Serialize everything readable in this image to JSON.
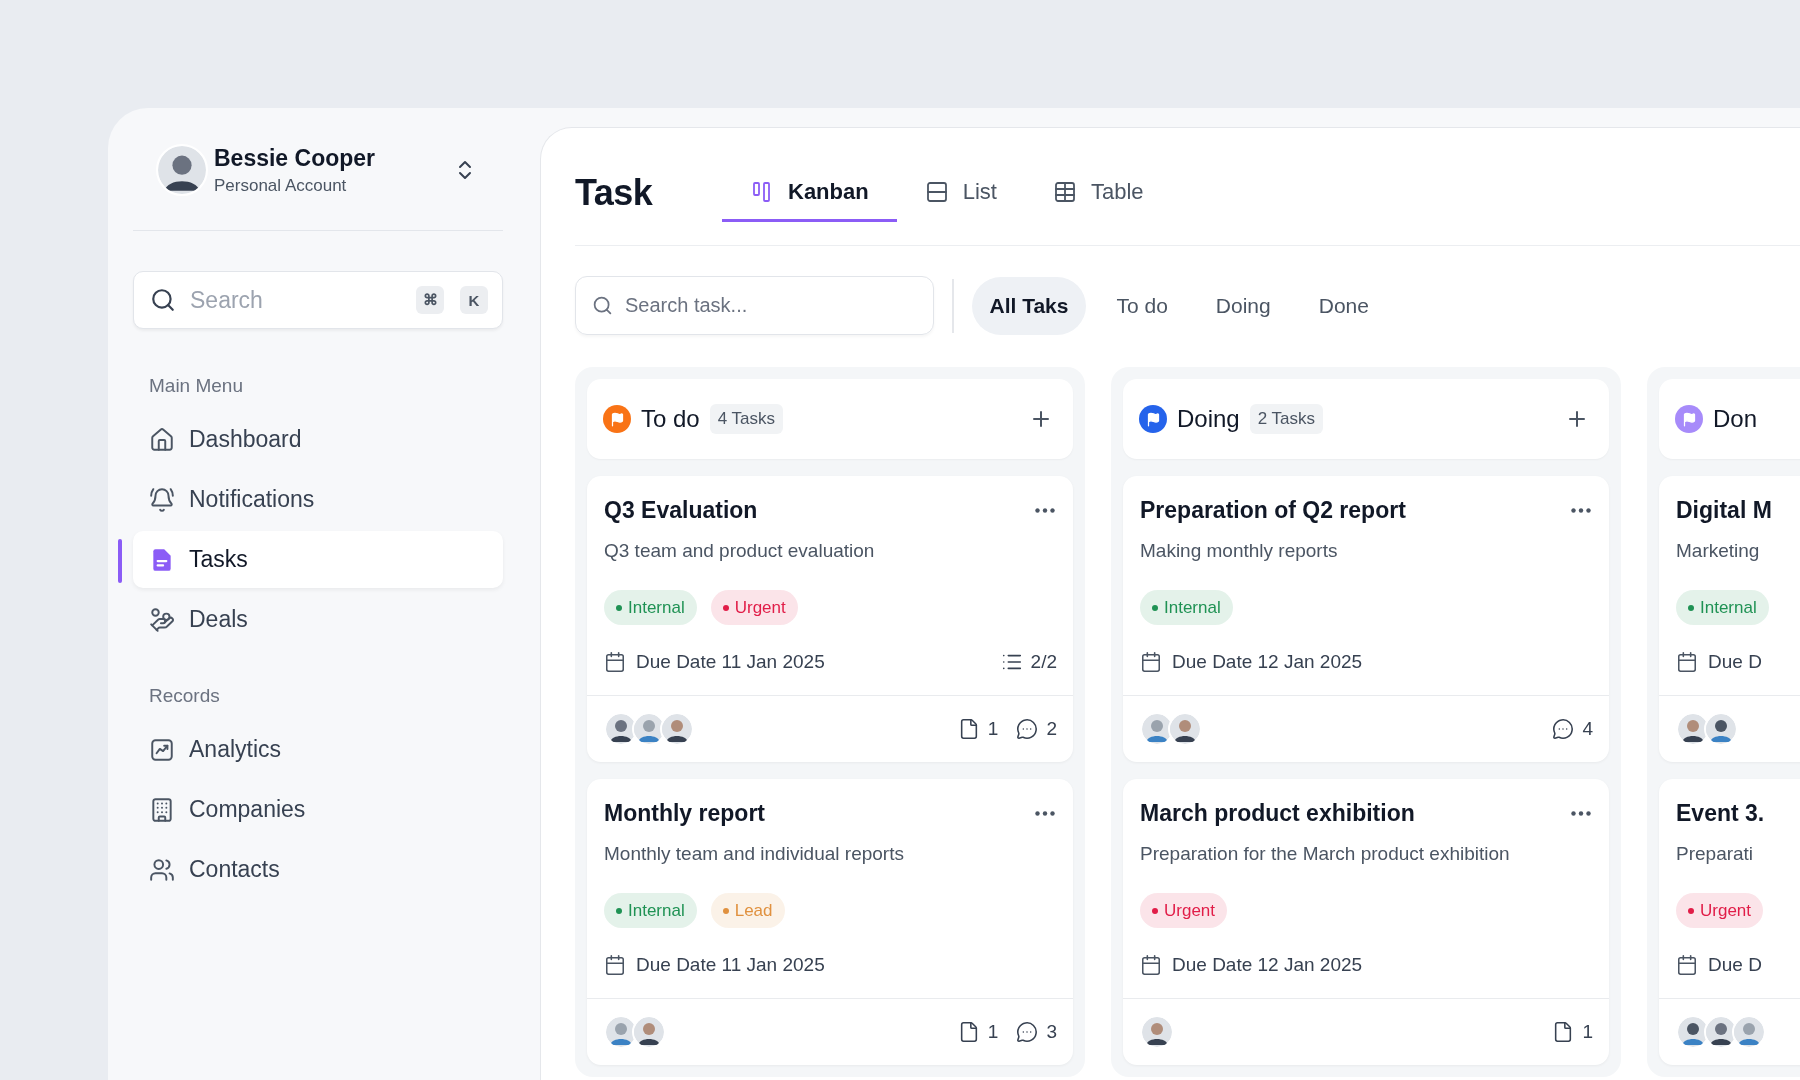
{
  "profile": {
    "name": "Bessie Cooper",
    "account": "Personal Account",
    "avatar": {
      "kind": "picture"
    }
  },
  "sidebar_search": {
    "placeholder": "Search",
    "keys": [
      "⌘",
      "K"
    ]
  },
  "sidebar": {
    "sections": [
      {
        "title": "Main Menu",
        "items": [
          {
            "label": "Dashboard",
            "selected": false
          },
          {
            "label": "Notifications",
            "selected": false
          },
          {
            "label": "Tasks",
            "selected": true
          },
          {
            "label": "Deals",
            "selected": false
          }
        ]
      },
      {
        "title": "Records",
        "items": [
          {
            "label": "Analytics",
            "selected": false
          },
          {
            "label": "Companies",
            "selected": false
          },
          {
            "label": "Contacts",
            "selected": false
          }
        ]
      }
    ]
  },
  "page_title": "Task",
  "view_tabs": [
    {
      "label": "Kanban",
      "selected": true
    },
    {
      "label": "List",
      "selected": false
    },
    {
      "label": "Table",
      "selected": false
    }
  ],
  "task_search": {
    "placeholder": "Search task..."
  },
  "filters": [
    {
      "label": "All Taks",
      "selected": true
    },
    {
      "label": "To do",
      "selected": false
    },
    {
      "label": "Doing",
      "selected": false
    },
    {
      "label": "Done",
      "selected": false
    }
  ],
  "columns": [
    {
      "title": "To do",
      "count": "4 Tasks",
      "color": "#f97316",
      "cards": [
        {
          "title": "Q3 Evaluation",
          "description": "Q3 team and product evaluation",
          "tags": [
            {
              "label": "Internal",
              "color": "#1f9254"
            },
            {
              "label": "Urgent",
              "color": "#e11d48"
            }
          ],
          "due": "Due Date 11 Jan 2025",
          "subtasks": "2/2",
          "avatars": [
            {
              "kind": "picture"
            },
            {
              "kind": "picture"
            },
            {
              "kind": "picture"
            }
          ],
          "attachments": "1",
          "comments": "2"
        },
        {
          "title": "Monthly report",
          "description": "Monthly team and individual reports",
          "tags": [
            {
              "label": "Internal",
              "color": "#1f9254"
            },
            {
              "label": "Lead",
              "color": "#e0913f"
            }
          ],
          "due": "Due Date 11 Jan 2025",
          "avatars": [
            {
              "kind": "picture"
            },
            {
              "kind": "picture"
            }
          ],
          "attachments": "1",
          "comments": "3"
        }
      ]
    },
    {
      "title": "Doing",
      "count": "2 Tasks",
      "color": "#2563eb",
      "cards": [
        {
          "title": "Preparation of Q2 report",
          "description": "Making monthly reports",
          "tags": [
            {
              "label": "Internal",
              "color": "#1f9254"
            }
          ],
          "due": "Due Date 12 Jan 2025",
          "avatars": [
            {
              "kind": "picture"
            },
            {
              "kind": "picture"
            }
          ],
          "comments": "4"
        },
        {
          "title": "March product exhibition",
          "description": "Preparation for the March product exhibition",
          "tags": [
            {
              "label": "Urgent",
              "color": "#e11d48"
            }
          ],
          "due": "Due Date 12 Jan 2025",
          "avatars": [
            {
              "kind": "picture"
            }
          ],
          "attachments": "1"
        }
      ]
    },
    {
      "title": "Don",
      "color": "#a78bfa",
      "cards": [
        {
          "title": "Digital M",
          "description": "Marketing",
          "tags": [
            {
              "label": "Internal",
              "color": "#1f9254"
            }
          ],
          "due": "Due D",
          "avatars": [
            {
              "kind": "picture"
            },
            {
              "kind": "picture"
            }
          ]
        },
        {
          "title": "Event 3.",
          "description": "Preparati",
          "tags": [
            {
              "label": "Urgent",
              "color": "#e11d48"
            }
          ],
          "due": "Due D",
          "avatars": [
            {
              "kind": "picture"
            },
            {
              "kind": "picture"
            },
            {
              "kind": "picture"
            }
          ]
        }
      ]
    }
  ]
}
